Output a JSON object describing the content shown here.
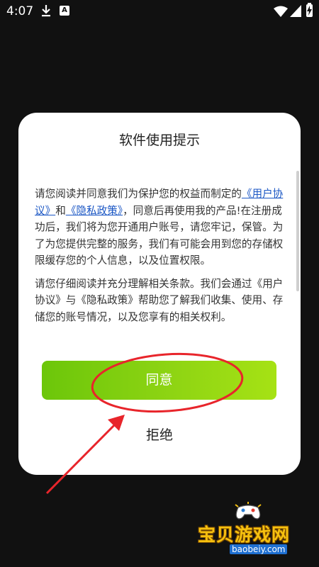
{
  "status_bar": {
    "time": "4:07",
    "app_badge": "A"
  },
  "dialog": {
    "title": "软件使用提示",
    "paragraph1": {
      "before": "请您阅读并同意我们为保护您的权益而制定的",
      "link1": "《用户协议》",
      "mid": "和",
      "link2": "《隐私政策》",
      "after": "，同意后再使用我的产品!在注册成功后，我们将为您开通用户账号，请您牢记，保管。为了为您提供完整的服务，我们有可能会用到您的存储权限缓存您的个人信息，以及位置权限。"
    },
    "paragraph2": "请您仔细阅读并充分理解相关条款。我们会通过《用户协议》与《隐私政策》帮助您了解我们收集、使用、存储您的账号情况，以及您享有的相关权利。",
    "agree_label": "同意",
    "reject_label": "拒绝"
  },
  "watermark": {
    "text": "宝贝游戏网",
    "url": "baobeiy.com"
  },
  "colors": {
    "annotation": "#e8252b",
    "agree_start": "#6cc60a",
    "agree_end": "#a6e214",
    "link": "#1a56c4"
  }
}
